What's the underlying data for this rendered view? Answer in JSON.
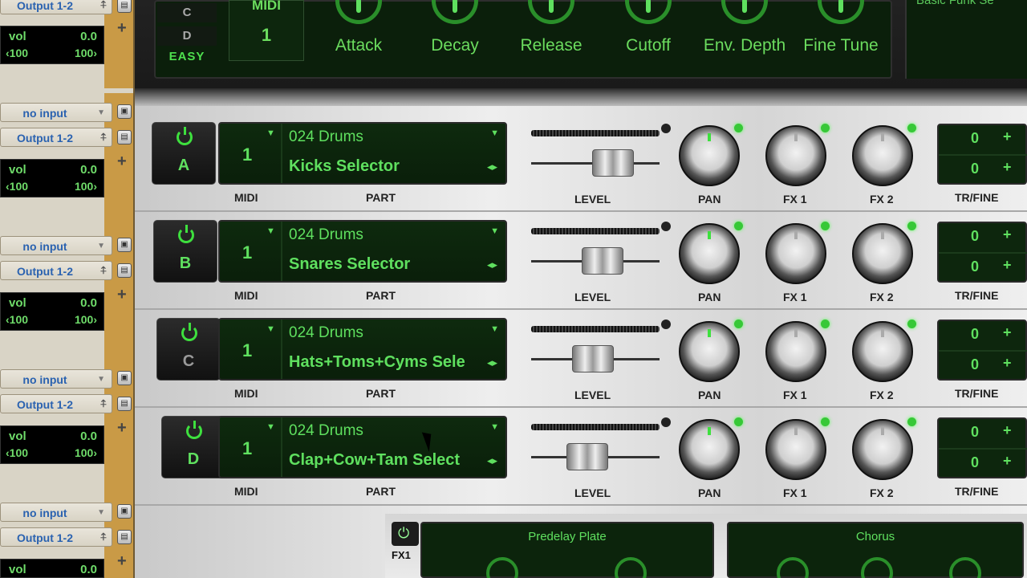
{
  "mixer_strip": {
    "channels": [
      {
        "input": "",
        "output": "Output 1-2",
        "vol_label": "vol",
        "vol_value": "0.0",
        "pan_left": "100",
        "pan_right": "100"
      },
      {
        "input": "no input",
        "output": "Output 1-2",
        "vol_label": "vol",
        "vol_value": "0.0",
        "pan_left": "100",
        "pan_right": "100"
      },
      {
        "input": "no input",
        "output": "Output 1-2",
        "vol_label": "vol",
        "vol_value": "0.0",
        "pan_left": "100",
        "pan_right": "100"
      },
      {
        "input": "no input",
        "output": "Output 1-2",
        "vol_label": "vol",
        "vol_value": "0.0",
        "pan_left": "100",
        "pan_right": "100"
      },
      {
        "input": "no input",
        "output": "Output 1-2",
        "vol_label": "vol",
        "vol_value": "0.0"
      }
    ]
  },
  "top": {
    "letters": [
      "C",
      "D"
    ],
    "easy": "EASY",
    "midi_title": "MIDI",
    "midi_value": "1",
    "envelope": [
      "Attack",
      "Decay",
      "Release",
      "Cutoff",
      "Env. Depth",
      "Fine Tune"
    ],
    "preset_name": "Basic Funk Se"
  },
  "captions": {
    "midi": "MIDI",
    "part": "PART",
    "level": "LEVEL",
    "pan": "PAN",
    "fx1": "FX 1",
    "fx2": "FX 2",
    "trfine": "TR/FINE"
  },
  "parts": [
    {
      "letter": "A",
      "midi": "1",
      "bank": "024 Drums",
      "patch": "Kicks Selector",
      "tr": "0",
      "fine": "0",
      "level": 0.7
    },
    {
      "letter": "B",
      "midi": "1",
      "bank": "024 Drums",
      "patch": "Snares Selector",
      "tr": "0",
      "fine": "0",
      "level": 0.58
    },
    {
      "letter": "C",
      "midi": "1",
      "bank": "024 Drums",
      "patch": "Hats+Toms+Cyms Sele",
      "tr": "0",
      "fine": "0",
      "level": 0.47
    },
    {
      "letter": "D",
      "midi": "1",
      "bank": "024 Drums",
      "patch": "Clap+Cow+Tam Select",
      "tr": "0",
      "fine": "0",
      "level": 0.41
    }
  ],
  "fx": {
    "label": "FX1",
    "boxes": [
      "Predelay Plate",
      "Chorus"
    ]
  },
  "colors": {
    "accent": "#5fe05f",
    "led_active": "#3ee03e",
    "letter_active": "#5fe05f",
    "letter_dim": "#9a9a9a"
  }
}
